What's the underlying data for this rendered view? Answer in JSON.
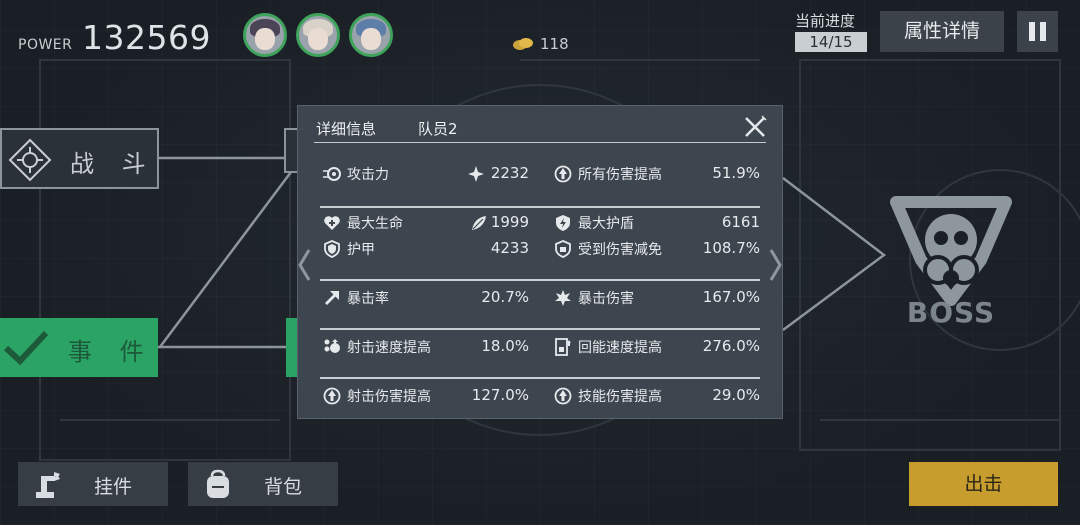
{
  "header": {
    "power_label": "POWER",
    "power_value": "132569",
    "coins": "118",
    "progress_label": "当前进度",
    "progress_value": "14/15",
    "attr_button": "属性详情"
  },
  "map": {
    "battle_label": "战 斗",
    "event_label": "事 件",
    "boss_label": "BOSS"
  },
  "dialog": {
    "title": "详细信息",
    "subtitle": "队员2",
    "stats": {
      "attack": {
        "name": "攻击力",
        "value": "2232"
      },
      "all_damage": {
        "name": "所有伤害提高",
        "value": "51.9%"
      },
      "max_hp": {
        "name": "最大生命",
        "value": "1999"
      },
      "max_shield": {
        "name": "最大护盾",
        "value": "6161"
      },
      "armor": {
        "name": "护甲",
        "value": "4233"
      },
      "damage_reduction": {
        "name": "受到伤害减免",
        "value": "108.7%"
      },
      "crit_rate": {
        "name": "暴击率",
        "value": "20.7%"
      },
      "crit_damage": {
        "name": "暴击伤害",
        "value": "167.0%"
      },
      "fire_rate": {
        "name": "射击速度提高",
        "value": "18.0%"
      },
      "energy_regen": {
        "name": "回能速度提高",
        "value": "276.0%"
      },
      "shot_damage": {
        "name": "射击伤害提高",
        "value": "127.0%"
      },
      "skill_damage": {
        "name": "技能伤害提高",
        "value": "29.0%"
      }
    }
  },
  "footer": {
    "addon_button": "挂件",
    "bag_button": "背包",
    "go_button": "出击"
  },
  "colors": {
    "accent_green": "#2aa365",
    "go_gold": "#c79d2e",
    "panel": "#3e464f"
  }
}
